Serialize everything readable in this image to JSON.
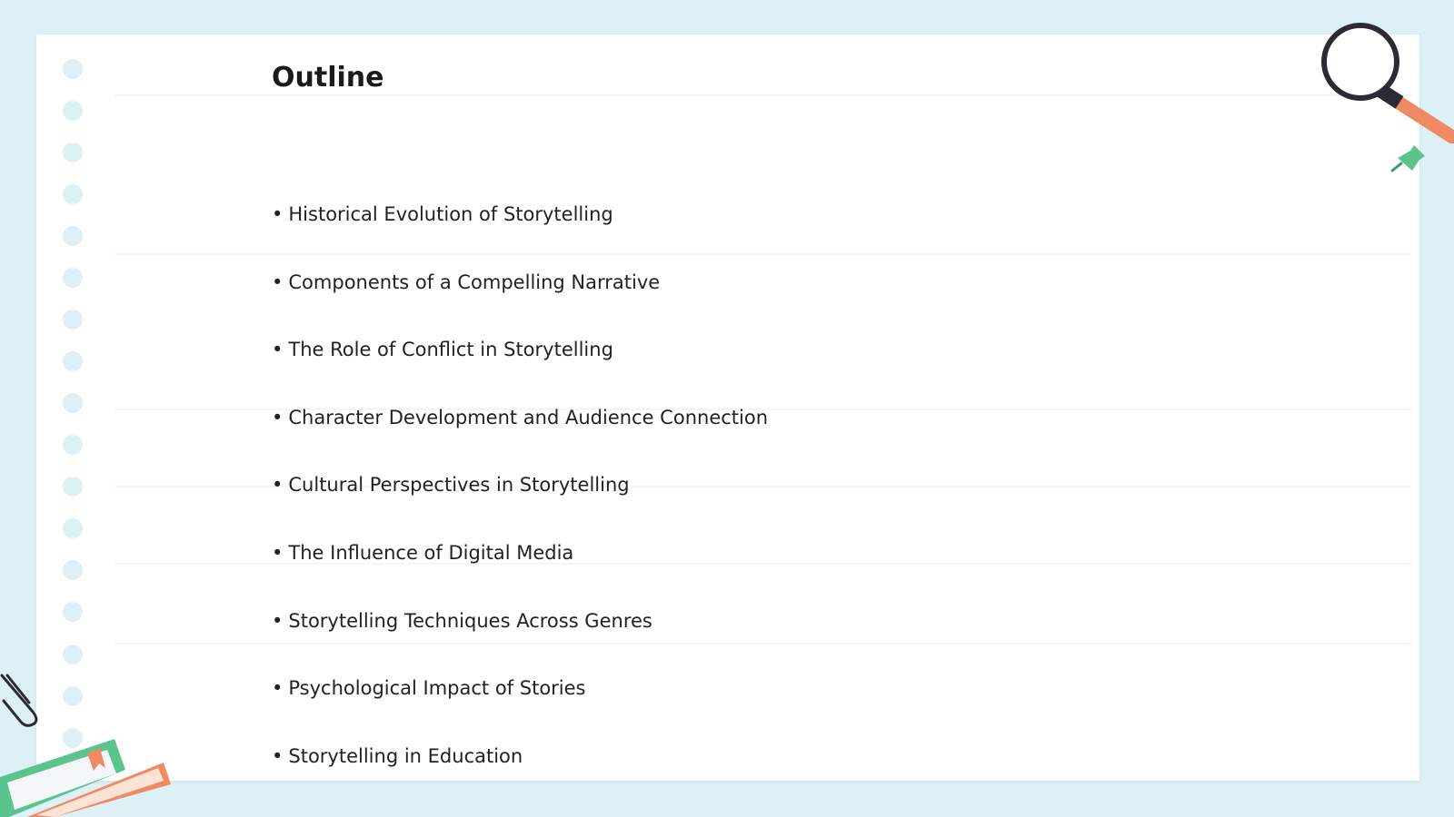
{
  "slide": {
    "title": "Outline",
    "bullet_glyph": "•",
    "items": [
      "Historical Evolution of Storytelling",
      "Components of a Compelling Narrative",
      "The Role of Conflict in Storytelling",
      "Character Development and Audience Connection",
      "Cultural Perspectives in Storytelling",
      "The Influence of Digital Media",
      "Storytelling Techniques Across Genres",
      "Psychological Impact of Stories",
      "Storytelling in Education"
    ]
  },
  "decorations": {
    "top_right": [
      "magnifying-glass-icon",
      "push-pin-icon"
    ],
    "bottom_left": [
      "paper-clip-icon",
      "books-icon"
    ]
  },
  "colors": {
    "background": "#dcf0f6",
    "paper": "#ffffff",
    "title_text": "#1b1b1b",
    "body_text": "#222222",
    "magnifier_handle": "#f08a63",
    "pin": "#5bc48e",
    "book_green": "#5bc48e",
    "book_orange": "#f08a63"
  }
}
